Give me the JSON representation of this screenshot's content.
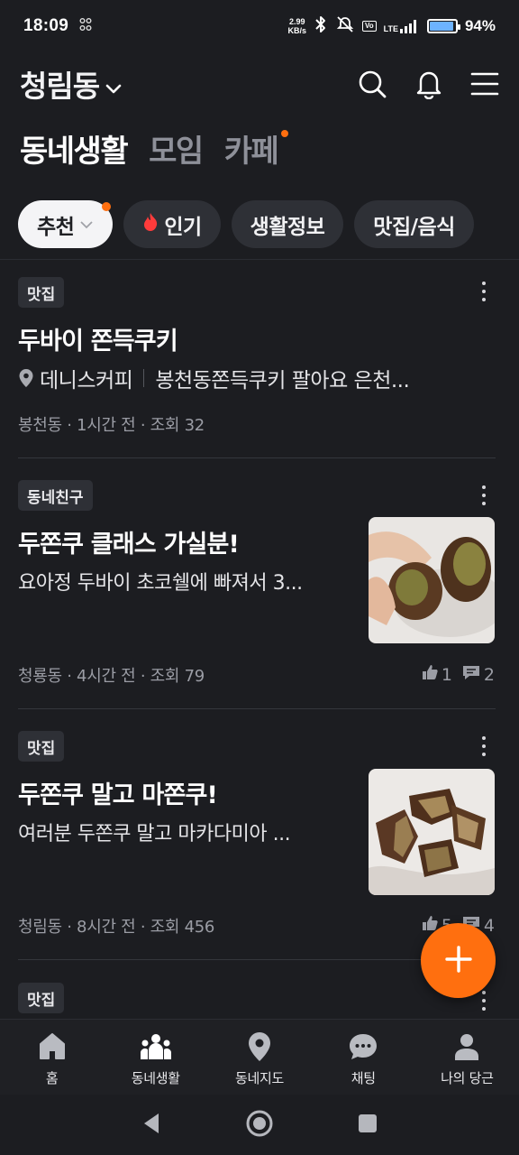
{
  "status_bar": {
    "time": "18:09",
    "net_speed_value": "2.99",
    "net_speed_unit": "KB/s",
    "lte_label": "LTE",
    "battery_percent": "94%",
    "battery_level": 0.94
  },
  "header": {
    "location": "청림동"
  },
  "top_tabs": [
    {
      "label": "동네생활",
      "active": true
    },
    {
      "label": "모임",
      "active": false
    },
    {
      "label": "카페",
      "active": false,
      "has_dot": true
    }
  ],
  "chips": [
    {
      "label": "추천",
      "active": true
    },
    {
      "label": "인기"
    },
    {
      "label": "생활정보"
    },
    {
      "label": "맛집/음식"
    }
  ],
  "posts": [
    {
      "tag": "맛집",
      "title": "두바이 쫀득쿠키",
      "place": "데니스커피",
      "body": "봉천동쫀득쿠키 팔아요 은천...",
      "meta": "봉천동 · 1시간 전 · 조회 32"
    },
    {
      "tag": "동네친구",
      "title": "두쫀쿠 클래스 가실분!",
      "body": "요아정 두바이 초코쉘에 빠져서 3...",
      "meta": "청룡동 · 4시간 전 · 조회 79",
      "likes": "1",
      "comments": "2"
    },
    {
      "tag": "맛집",
      "title": "두쫀쿠 말고 마쫀쿠!",
      "body": "여러분 두쫀쿠 말고 마카다미아 ...",
      "meta": "청림동 · 8시간 전 · 조회 456",
      "likes": "5",
      "comments": "4"
    },
    {
      "tag": "맛집"
    }
  ],
  "bottom_nav": [
    {
      "label": "홈",
      "icon": "home-icon"
    },
    {
      "label": "동네생활",
      "icon": "community-icon"
    },
    {
      "label": "동네지도",
      "icon": "map-pin-icon"
    },
    {
      "label": "채팅",
      "icon": "chat-icon"
    },
    {
      "label": "나의 당근",
      "icon": "person-icon"
    }
  ],
  "colors": {
    "background": "#1c1d21",
    "accent": "#ff6f0f",
    "chip_bg": "#2e3036",
    "meta_text": "#9b9da5"
  }
}
